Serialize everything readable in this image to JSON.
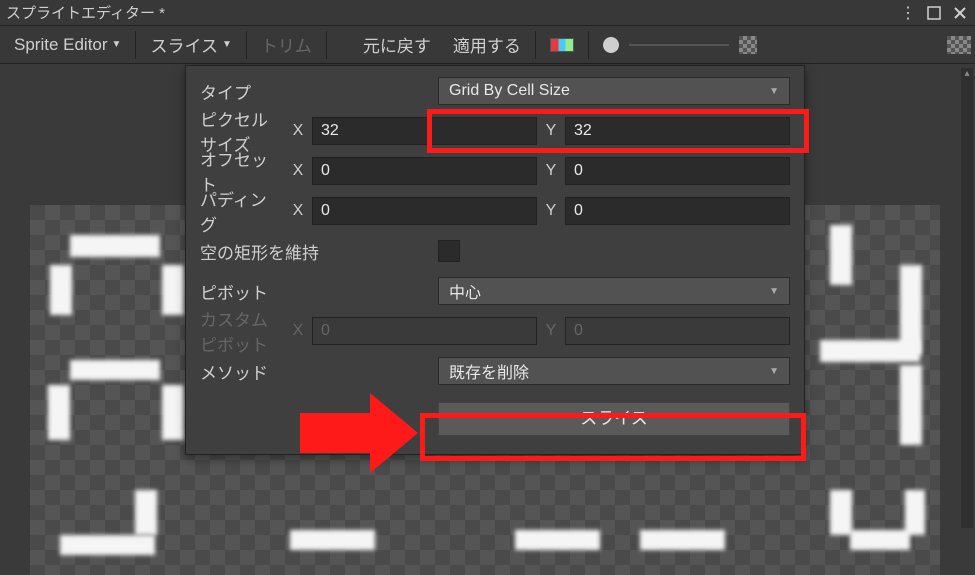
{
  "window": {
    "title": "スプライトエディター *"
  },
  "toolbar": {
    "sprite_editor": "Sprite Editor",
    "slice": "スライス",
    "trim": "トリム",
    "revert": "元に戻す",
    "apply": "適用する"
  },
  "panel": {
    "labels": {
      "type": "タイプ",
      "pixel_size": "ピクセルサイズ",
      "offset": "オフセット",
      "padding": "パディング",
      "keep_empty": "空の矩形を維持",
      "pivot": "ピボット",
      "custom_pivot": "カスタムピボット",
      "method": "メソッド"
    },
    "type_value": "Grid By Cell Size",
    "pixel_size": {
      "x": "32",
      "y": "32"
    },
    "offset": {
      "x": "0",
      "y": "0"
    },
    "padding": {
      "x": "0",
      "y": "0"
    },
    "pivot_value": "中心",
    "custom_pivot": {
      "x": "0",
      "y": "0"
    },
    "method_value": "既存を削除",
    "slice_button": "スライス",
    "xy_labels": {
      "x": "X",
      "y": "Y"
    }
  }
}
